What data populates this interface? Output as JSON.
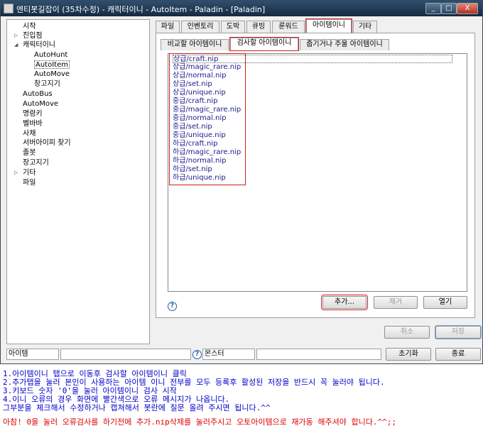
{
  "window": {
    "title": "엔티봇길잡이 (35차수정) - 캐릭터이니 - AutoItem - Paladin - [Paladin]",
    "minimize": "_",
    "maximize": "□",
    "close": "X"
  },
  "tree": {
    "items": [
      {
        "label": "시작"
      },
      {
        "label": "진입점"
      },
      {
        "label": "캐릭터이니"
      },
      {
        "label": "AutoHunt"
      },
      {
        "label": "AutoItem"
      },
      {
        "label": "AutoMove"
      },
      {
        "label": "창고지기"
      },
      {
        "label": "AutoBus"
      },
      {
        "label": "AutoMove"
      },
      {
        "label": "명령키"
      },
      {
        "label": "벨바바"
      },
      {
        "label": "사채"
      },
      {
        "label": "서버아이피 찾기"
      },
      {
        "label": "졸봇"
      },
      {
        "label": "장고지기"
      },
      {
        "label": "기타"
      },
      {
        "label": "파일"
      }
    ]
  },
  "tabs": [
    "파일",
    "인벤토리",
    "도박",
    "큐빙",
    "룬워드",
    "아이템이니",
    "기타"
  ],
  "subtabs": [
    "비교할 아이템이니",
    "검사할 아이템이니",
    "줍기거나 주울 아이템이니"
  ],
  "list": {
    "items": [
      "상급/craft.nip",
      "상급/magic_rare.nip",
      "상급/normal.nip",
      "상급/set.nip",
      "상급/unique.nip",
      "중급/craft.nip",
      "중급/magic_rare.nip",
      "중급/normal.nip",
      "중급/set.nip",
      "중급/unique.nip",
      "하급/craft.nip",
      "하급/magic_rare.nip",
      "하급/normal.nip",
      "하급/set.nip",
      "하급/unique.nip"
    ]
  },
  "buttons": {
    "add": "추가...",
    "remove": "제거",
    "open": "열기",
    "cancel": "취소",
    "save": "저장",
    "reset": "초기화",
    "exit": "종료",
    "help": "?"
  },
  "status": {
    "left_field": "아이템",
    "right_field": "몬스터"
  },
  "notes": [
    "1.아이템이니 탭으로 이동후 검사할 아이템이니 클릭",
    "2.추가탭을 눌러 본인이 사용하는 아이템 이니 전부를 모두 등록후 활성된 저장을 반드시 꼭 눌러야 됩니다.",
    "3.키보드 숫자 '0'을 눌러 아이템이니 검사 시작",
    "4.이니 오류의 경우 화면에 빨간색으로 오류 메시지가 나옵니다.",
    "  그부분을 체크해서 수정하거나 캡쳐해서 봇란에  질문 올려 주시면 됩니다.^^"
  ],
  "warning": "아참! 0을 눌러 오류검사를 하기전에 추가.nip삭제를 눌러주시고 오토아이템으로 재가동 해주셔야 합니다.^^;;"
}
